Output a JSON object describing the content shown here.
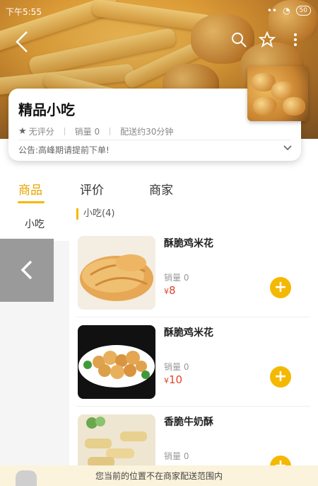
{
  "status_bar": {
    "time": "下午5:55",
    "battery": "50"
  },
  "shop": {
    "name": "精品小吃",
    "rating": "无评分",
    "sales": "销量 0",
    "delivery": "配送约30分钟",
    "notice": "公告:高峰期请提前下单!"
  },
  "tabs": [
    {
      "label": "商品"
    },
    {
      "label": "评价"
    },
    {
      "label": "商家"
    }
  ],
  "categories": [
    {
      "label": "小吃"
    }
  ],
  "section": {
    "title": "小吃(4)"
  },
  "products": [
    {
      "name": "酥脆鸡米花",
      "sales": "销量 0",
      "currency": "¥",
      "price": "8"
    },
    {
      "name": "酥脆鸡米花",
      "sales": "销量 0",
      "currency": "¥",
      "price": "10"
    },
    {
      "name": "香脆牛奶酥",
      "sales": "销量 0",
      "currency": "¥",
      "price": ""
    }
  ],
  "bottom_notice": "您当前的位置不在商家配送范围内",
  "colors": {
    "accent": "#f5b800",
    "price": "#e0452d"
  },
  "icons": [
    "back-arrow-icon",
    "search-icon",
    "star-icon",
    "more-icon",
    "chevron-down-icon",
    "plus-icon",
    "cart-icon"
  ]
}
